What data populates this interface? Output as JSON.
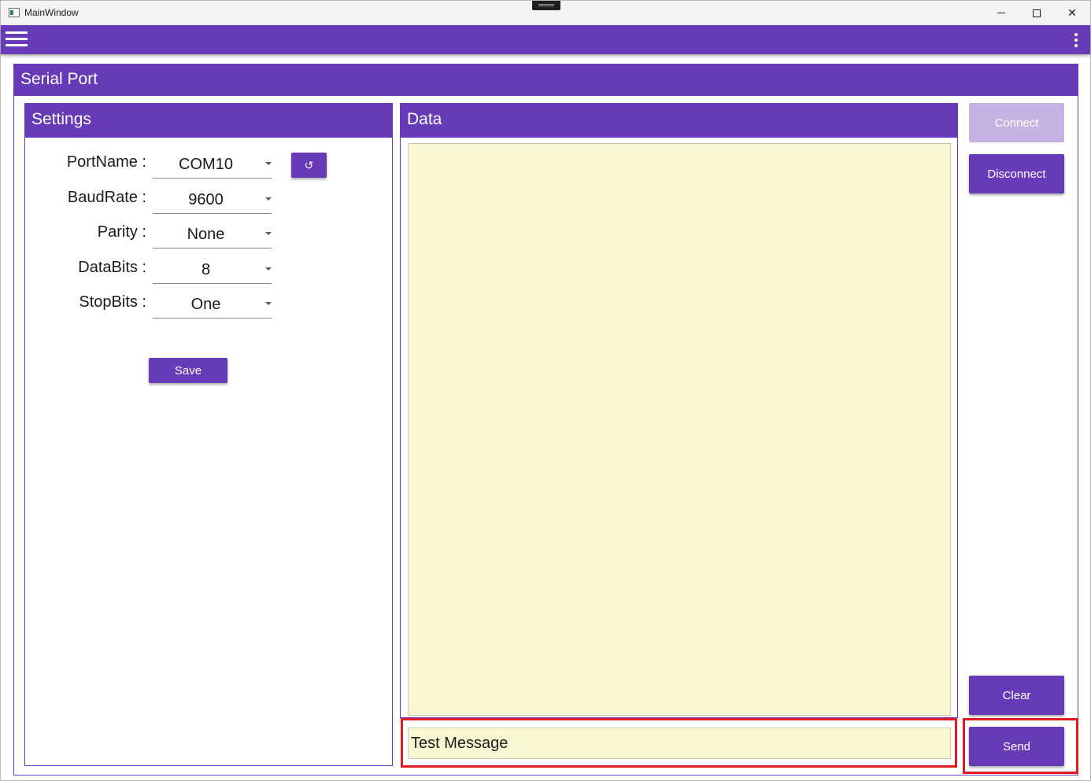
{
  "window": {
    "title": "MainWindow",
    "icon": "app-window-icon"
  },
  "window_controls": {
    "minimize_icon": "minimize-icon",
    "maximize_icon": "maximize-icon",
    "close_glyph": "✕"
  },
  "appbar": {
    "menu_icon": "hamburger-menu-icon",
    "more_icon": "more-vertical-icon",
    "color": "#673ab7"
  },
  "serial_port": {
    "title": "Serial Port"
  },
  "settings": {
    "title": "Settings",
    "fields": [
      {
        "label": "PortName :",
        "value": "COM10"
      },
      {
        "label": "BaudRate :",
        "value": "9600"
      },
      {
        "label": "Parity :",
        "value": "None"
      },
      {
        "label": "DataBits :",
        "value": "8"
      },
      {
        "label": "StopBits :",
        "value": "One"
      }
    ],
    "refresh_glyph": "↺",
    "refresh_icon": "refresh-icon",
    "save_label": "Save"
  },
  "data": {
    "title": "Data",
    "received_text": "",
    "message_value": "Test Message",
    "data_area_color": "#f7f8d1"
  },
  "actions": {
    "connect_label": "Connect",
    "disconnect_label": "Disconnect",
    "clear_label": "Clear",
    "send_label": "Send"
  },
  "colors": {
    "accent": "#673ab7",
    "accent_disabled": "#c5b4e3",
    "highlight": "#e01b24"
  }
}
